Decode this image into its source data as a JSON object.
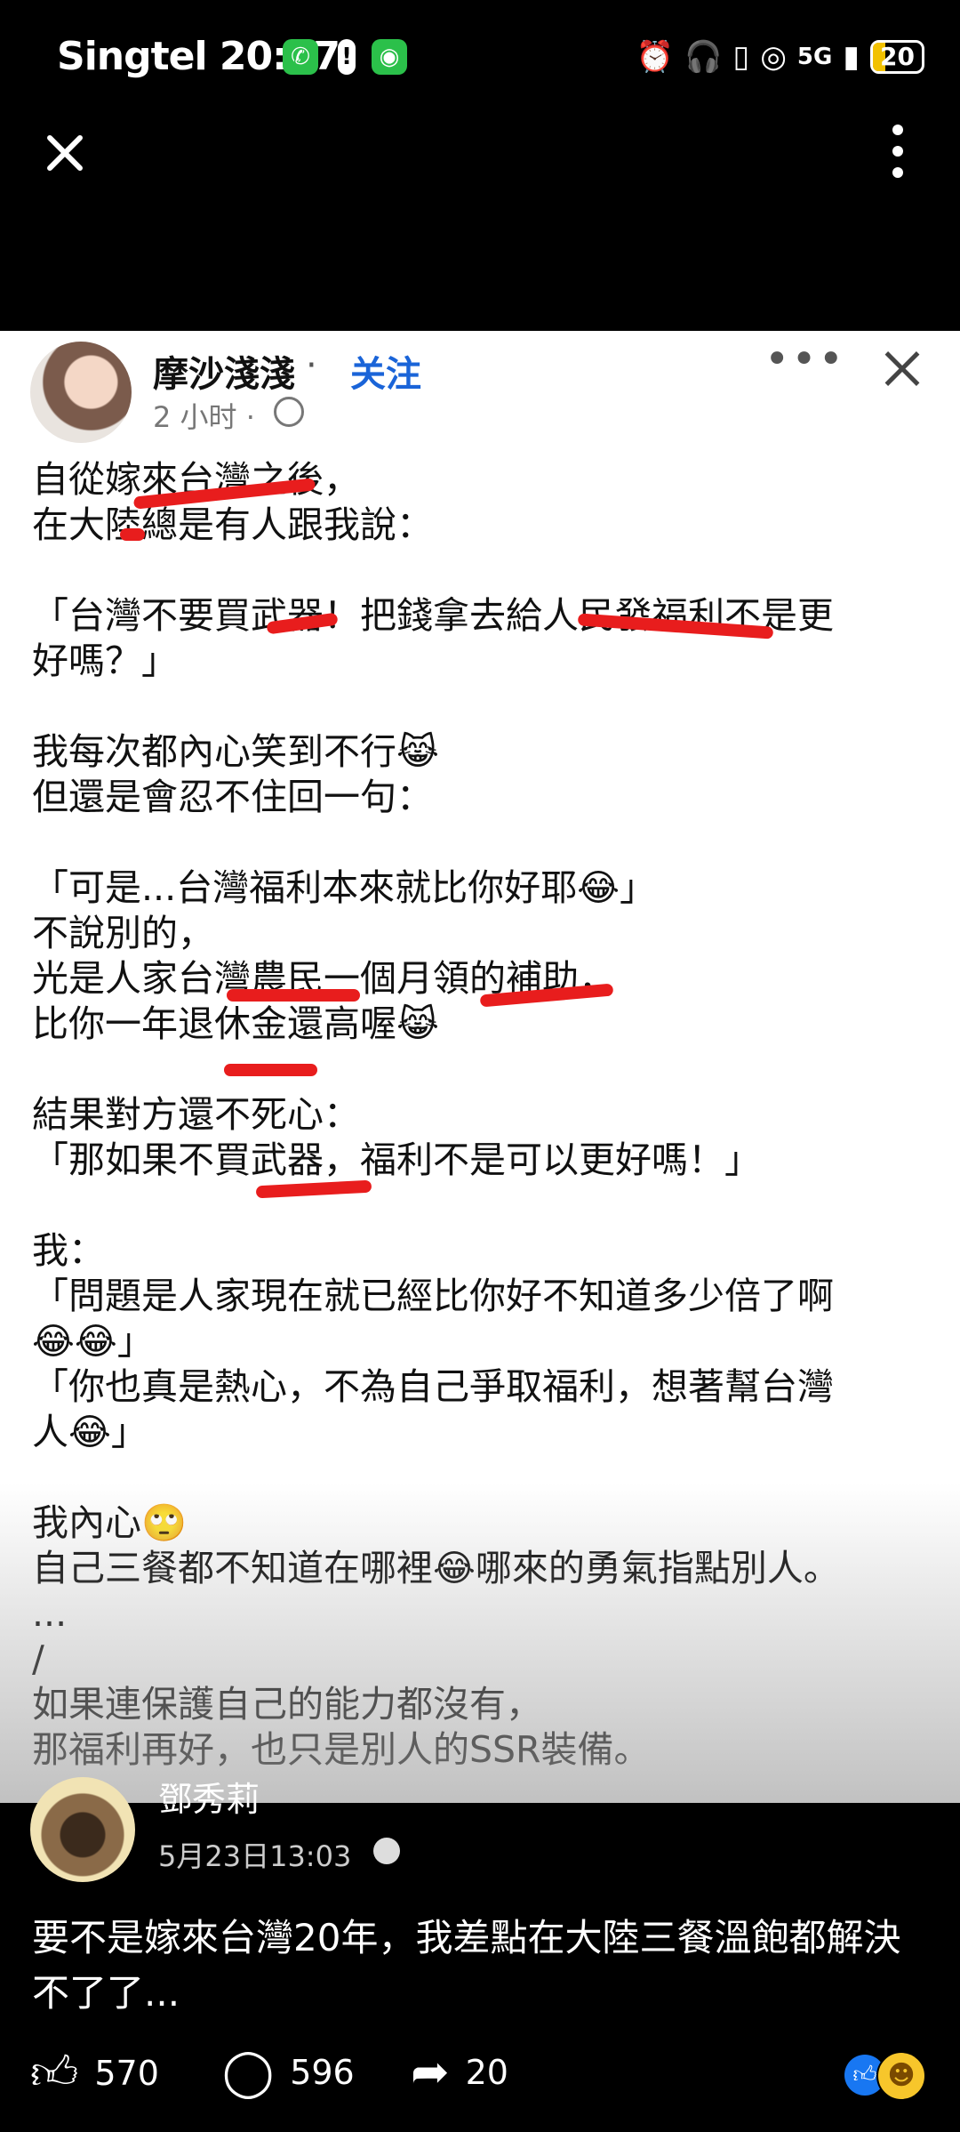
{
  "status_bar": {
    "carrier": "Singtel",
    "time": "20:27",
    "network": "5G",
    "battery": "20"
  },
  "toolbar": {
    "close_icon": "close-icon",
    "more_icon": "more-vertical-icon"
  },
  "embedded_post": {
    "author": "摩沙淺淺",
    "dot": "·",
    "follow_label": "关注",
    "time": "2 小时 ·",
    "body": "自從嫁來台灣之後，\n在大陸總是有人跟我說：\n\n「台灣不要買武器！把錢拿去給人民發福利不是更\n好嗎？」\n\n我每次都內心笑到不行😹\n但還是會忍不住回一句：\n\n「可是...台灣福利本來就比你好耶😂」\n不說別的，\n光是人家台灣農民一個月領的補助，\n比你一年退休金還高喔😹\n\n結果對方還不死心：\n「那如果不買武器，福利不是可以更好嗎！」\n\n我：\n「問題是人家現在就已經比你好不知道多少倍了啊\n😂😂」\n「你也真是熱心，不為自己爭取福利，想著幫台灣\n人😂」\n\n我內心🙄\n自己三餐都不知道在哪裡😂哪來的勇氣指點別人。\n...\n/\n如果連保護自己的能力都沒有，\n那福利再好，也只是別人的SSR裝備。"
  },
  "comment": {
    "author": "鄧秀莉",
    "date": "5月23日13:03",
    "text": "要不是嫁來台灣20年，我差點在大陸三餐溫飽都解決不了了..."
  },
  "actions": {
    "likes": "570",
    "comments": "596",
    "shares": "20"
  }
}
